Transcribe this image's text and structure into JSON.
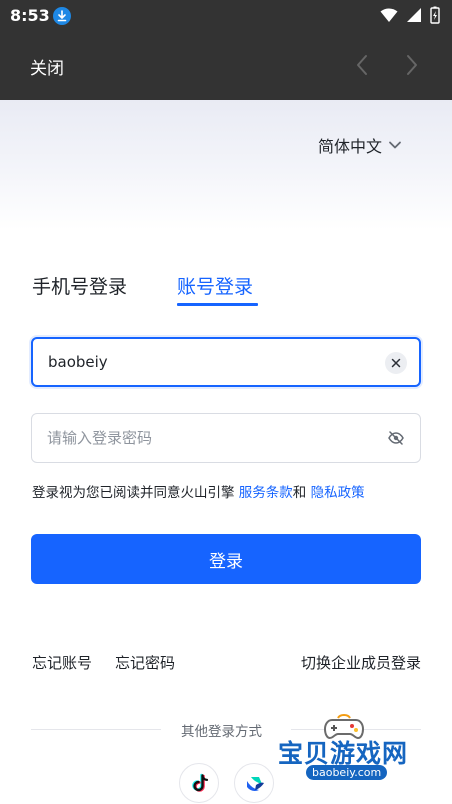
{
  "status_bar": {
    "time": "8:53"
  },
  "top_bar": {
    "close_label": "关闭"
  },
  "language": {
    "selected": "简体中文"
  },
  "tabs": [
    {
      "label": "手机号登录",
      "active": false
    },
    {
      "label": "账号登录",
      "active": true
    }
  ],
  "form": {
    "username_value": "baobeiy",
    "password_value": "",
    "password_placeholder": "请输入登录密码"
  },
  "agreement": {
    "prefix": "登录视为您已阅读并同意火山引擎 ",
    "terms_link": "服务条款",
    "conjunction": "和 ",
    "privacy_link": "隐私政策"
  },
  "login_button": "登录",
  "links": {
    "forgot_account": "忘记账号",
    "forgot_password": "忘记密码",
    "switch_enterprise": "切换企业成员登录"
  },
  "other_login": {
    "label": "其他登录方式",
    "providers": [
      {
        "icon": "douyin-icon"
      },
      {
        "icon": "feishu-icon"
      }
    ]
  },
  "watermark": {
    "title": "宝贝游戏网",
    "url": "baobeiy.com"
  },
  "colors": {
    "accent": "#1664ff",
    "top_bar": "#333333",
    "text": "#1f2329",
    "muted": "#8f959e"
  }
}
